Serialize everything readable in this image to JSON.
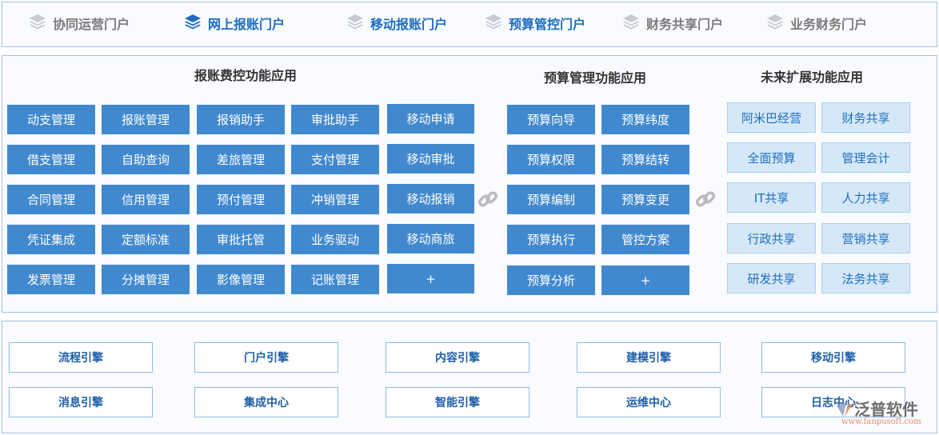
{
  "nav": [
    {
      "label": "协同运营门户",
      "active": false,
      "blue": false
    },
    {
      "label": "网上报账门户",
      "active": true,
      "blue": true
    },
    {
      "label": "移动报账门户",
      "active": false,
      "blue": true
    },
    {
      "label": "预算管控门户",
      "active": false,
      "blue": true
    },
    {
      "label": "财务共享门户",
      "active": false,
      "blue": false
    },
    {
      "label": "业务财务门户",
      "active": false,
      "blue": false
    }
  ],
  "sections": {
    "expense": "报账费控功能应用",
    "budget": "预算管理功能应用",
    "future": "未来扩展功能应用"
  },
  "expense_grid": [
    [
      "动支管理",
      "报账管理",
      "报销助手",
      "审批助手"
    ],
    [
      "借支管理",
      "自助查询",
      "差旅管理",
      "支付管理"
    ],
    [
      "合同管理",
      "信用管理",
      "预付管理",
      "冲销管理"
    ],
    [
      "凭证集成",
      "定额标准",
      "审批托管",
      "业务驱动"
    ],
    [
      "发票管理",
      "分摊管理",
      "影像管理",
      "记账管理"
    ]
  ],
  "mobile": [
    "移动申请",
    "移动审批",
    "移动报销",
    "移动商旅",
    "+"
  ],
  "budget_grid": [
    [
      "预算向导",
      "预算纬度"
    ],
    [
      "预算权限",
      "预算结转"
    ],
    [
      "预算编制",
      "预算变更"
    ],
    [
      "预算执行",
      "管控方案"
    ],
    [
      "预算分析",
      "+"
    ]
  ],
  "future_grid": [
    [
      "阿米巴经营",
      "财务共享"
    ],
    [
      "全面预算",
      "管理会计"
    ],
    [
      "IT共享",
      "人力共享"
    ],
    [
      "行政共享",
      "营销共享"
    ],
    [
      "研发共享",
      "法务共享"
    ]
  ],
  "engines": [
    [
      "流程引擎",
      "门户引擎",
      "内容引擎",
      "建模引擎",
      "移动引擎"
    ],
    [
      "消息引擎",
      "集成中心",
      "智能引擎",
      "运维中心",
      "日志中心"
    ]
  ],
  "watermark": {
    "name": "泛普软件",
    "url": "www.fanpusoft.com"
  },
  "colors": {
    "primary": "#4189cf",
    "light": "#d6e8f8",
    "active_nav": "#1d6cc2"
  }
}
